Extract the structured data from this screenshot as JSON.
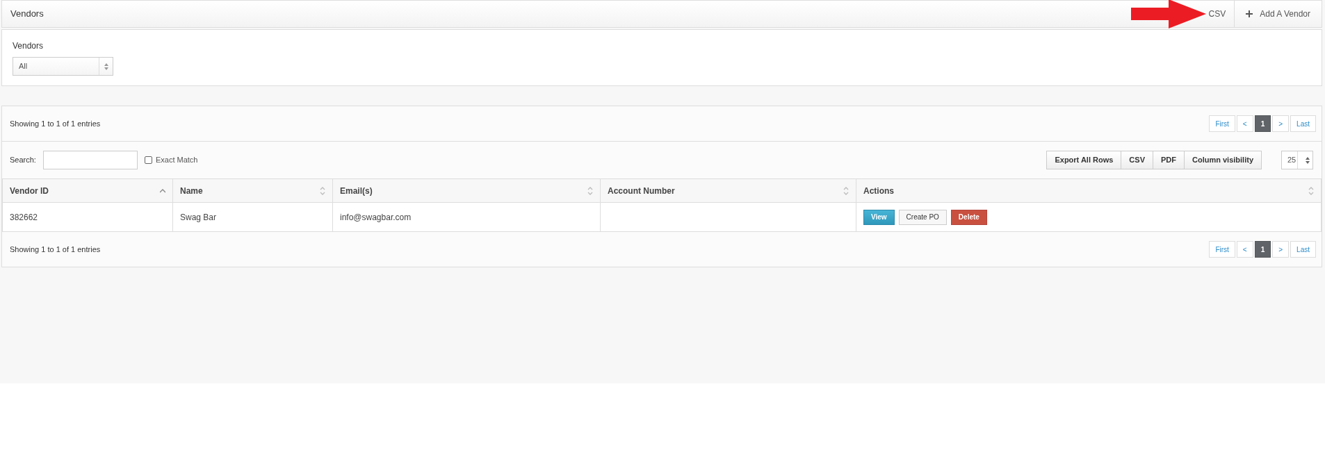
{
  "header": {
    "title": "Vendors",
    "buttons": [
      {
        "label": "CSV",
        "kind": "covered"
      },
      {
        "label": "Add A Vendor",
        "kind": "add"
      }
    ]
  },
  "annotation": {
    "kind": "arrow"
  },
  "filter": {
    "label": "Vendors",
    "value": "All"
  },
  "table": {
    "info_top": "Showing 1 to 1 of 1 entries",
    "info_bottom": "Showing 1 to 1 of 1 entries",
    "pagination_top": [
      {
        "label": "First",
        "selected": false
      },
      {
        "label": "<",
        "selected": false
      },
      {
        "label": "1",
        "selected": true
      },
      {
        "label": ">",
        "selected": false
      },
      {
        "label": "Last",
        "selected": false
      }
    ],
    "pagination_bottom": [
      {
        "label": "First",
        "selected": false
      },
      {
        "label": "<",
        "selected": false
      },
      {
        "label": "1",
        "selected": true
      },
      {
        "label": ">",
        "selected": false
      },
      {
        "label": "Last",
        "selected": false
      }
    ],
    "search": {
      "label": "Search:"
    },
    "exact_match": {
      "label": "Exact Match",
      "checked": false
    },
    "export_buttons": [
      "Export All Rows",
      "CSV",
      "PDF",
      "Column visibility"
    ],
    "page_length": "25",
    "columns": [
      {
        "label": "Vendor ID",
        "sorted": true
      },
      {
        "label": "Name",
        "sorted": false
      },
      {
        "label": "Email(s)",
        "sorted": false
      },
      {
        "label": "Account Number",
        "sorted": false
      },
      {
        "label": "Actions",
        "sorted": false
      }
    ],
    "rows": [
      {
        "cells": [
          "382662",
          "Swag Bar",
          "info@swagbar.com",
          null
        ],
        "actions": [
          {
            "label": "View",
            "kind": "info"
          },
          {
            "label": "Create PO",
            "kind": "default"
          },
          {
            "label": "Delete",
            "kind": "danger"
          }
        ]
      }
    ]
  }
}
